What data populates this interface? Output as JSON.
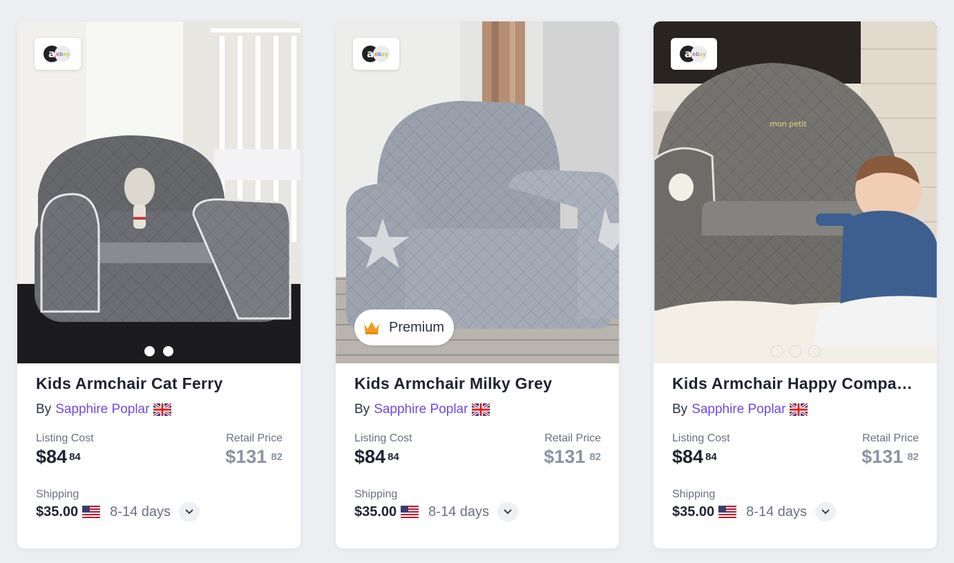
{
  "products": [
    {
      "title": "Kids Armchair Cat Ferry",
      "by_label": "By",
      "seller": "Sapphire Poplar",
      "seller_flag": "uk-flag-icon",
      "source_icon": "amazon-ebay-icon",
      "premium": null,
      "image_count": 2,
      "active_image": 1,
      "listing_label": "Listing Cost",
      "listing_major": "$84",
      "listing_minor": "84",
      "retail_label": "Retail Price",
      "retail_major": "$131",
      "retail_minor": "82",
      "shipping_label": "Shipping",
      "shipping_cost": "$35.00",
      "shipping_flag": "us-flag-icon",
      "shipping_days": "8-14 days"
    },
    {
      "title": "Kids Armchair Milky Grey",
      "by_label": "By",
      "seller": "Sapphire Poplar",
      "seller_flag": "uk-flag-icon",
      "source_icon": "amazon-ebay-icon",
      "premium": "Premium",
      "image_count": 0,
      "active_image": 0,
      "listing_label": "Listing Cost",
      "listing_major": "$84",
      "listing_minor": "84",
      "retail_label": "Retail Price",
      "retail_major": "$131",
      "retail_minor": "82",
      "shipping_label": "Shipping",
      "shipping_cost": "$35.00",
      "shipping_flag": "us-flag-icon",
      "shipping_days": "8-14 days"
    },
    {
      "title": "Kids Armchair Happy Compani…",
      "by_label": "By",
      "seller": "Sapphire Poplar",
      "seller_flag": "uk-flag-icon",
      "source_icon": "amazon-ebay-icon",
      "premium": null,
      "image_count": 3,
      "active_image": 0,
      "listing_label": "Listing Cost",
      "listing_major": "$84",
      "listing_minor": "84",
      "retail_label": "Retail Price",
      "retail_major": "$131",
      "retail_minor": "82",
      "shipping_label": "Shipping",
      "shipping_cost": "$35.00",
      "shipping_flag": "us-flag-icon",
      "shipping_days": "8-14 days"
    }
  ],
  "colors": {
    "accent": "#7048e8",
    "page_bg": "#eceef2",
    "muted_price": "#8a93a3",
    "premium_crown": "#f39c1f"
  }
}
